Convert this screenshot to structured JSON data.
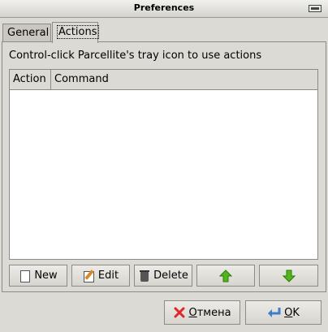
{
  "window": {
    "title": "Preferences"
  },
  "tabs": [
    {
      "label": "General"
    },
    {
      "label": "Actions"
    }
  ],
  "actions_tab": {
    "hint": "Control-click Parcellite's tray icon to use actions",
    "columns": [
      "Action",
      "Command"
    ],
    "rows": []
  },
  "buttons": {
    "new": "New",
    "edit": "Edit",
    "delete": "Delete",
    "cancel_mnemonic": "О",
    "cancel_rest": "тмена",
    "ok_mnemonic": "O",
    "ok_rest": "K"
  },
  "icons": {
    "new": "page-icon",
    "edit": "edit-icon",
    "delete": "trash-icon",
    "up": "up-arrow-icon",
    "down": "down-arrow-icon",
    "cancel": "red-x-icon",
    "ok": "return-arrow-icon"
  },
  "colors": {
    "arrow_green": "#52b51c",
    "cancel_red": "#e0262a",
    "ok_blue": "#3f7ec9"
  }
}
